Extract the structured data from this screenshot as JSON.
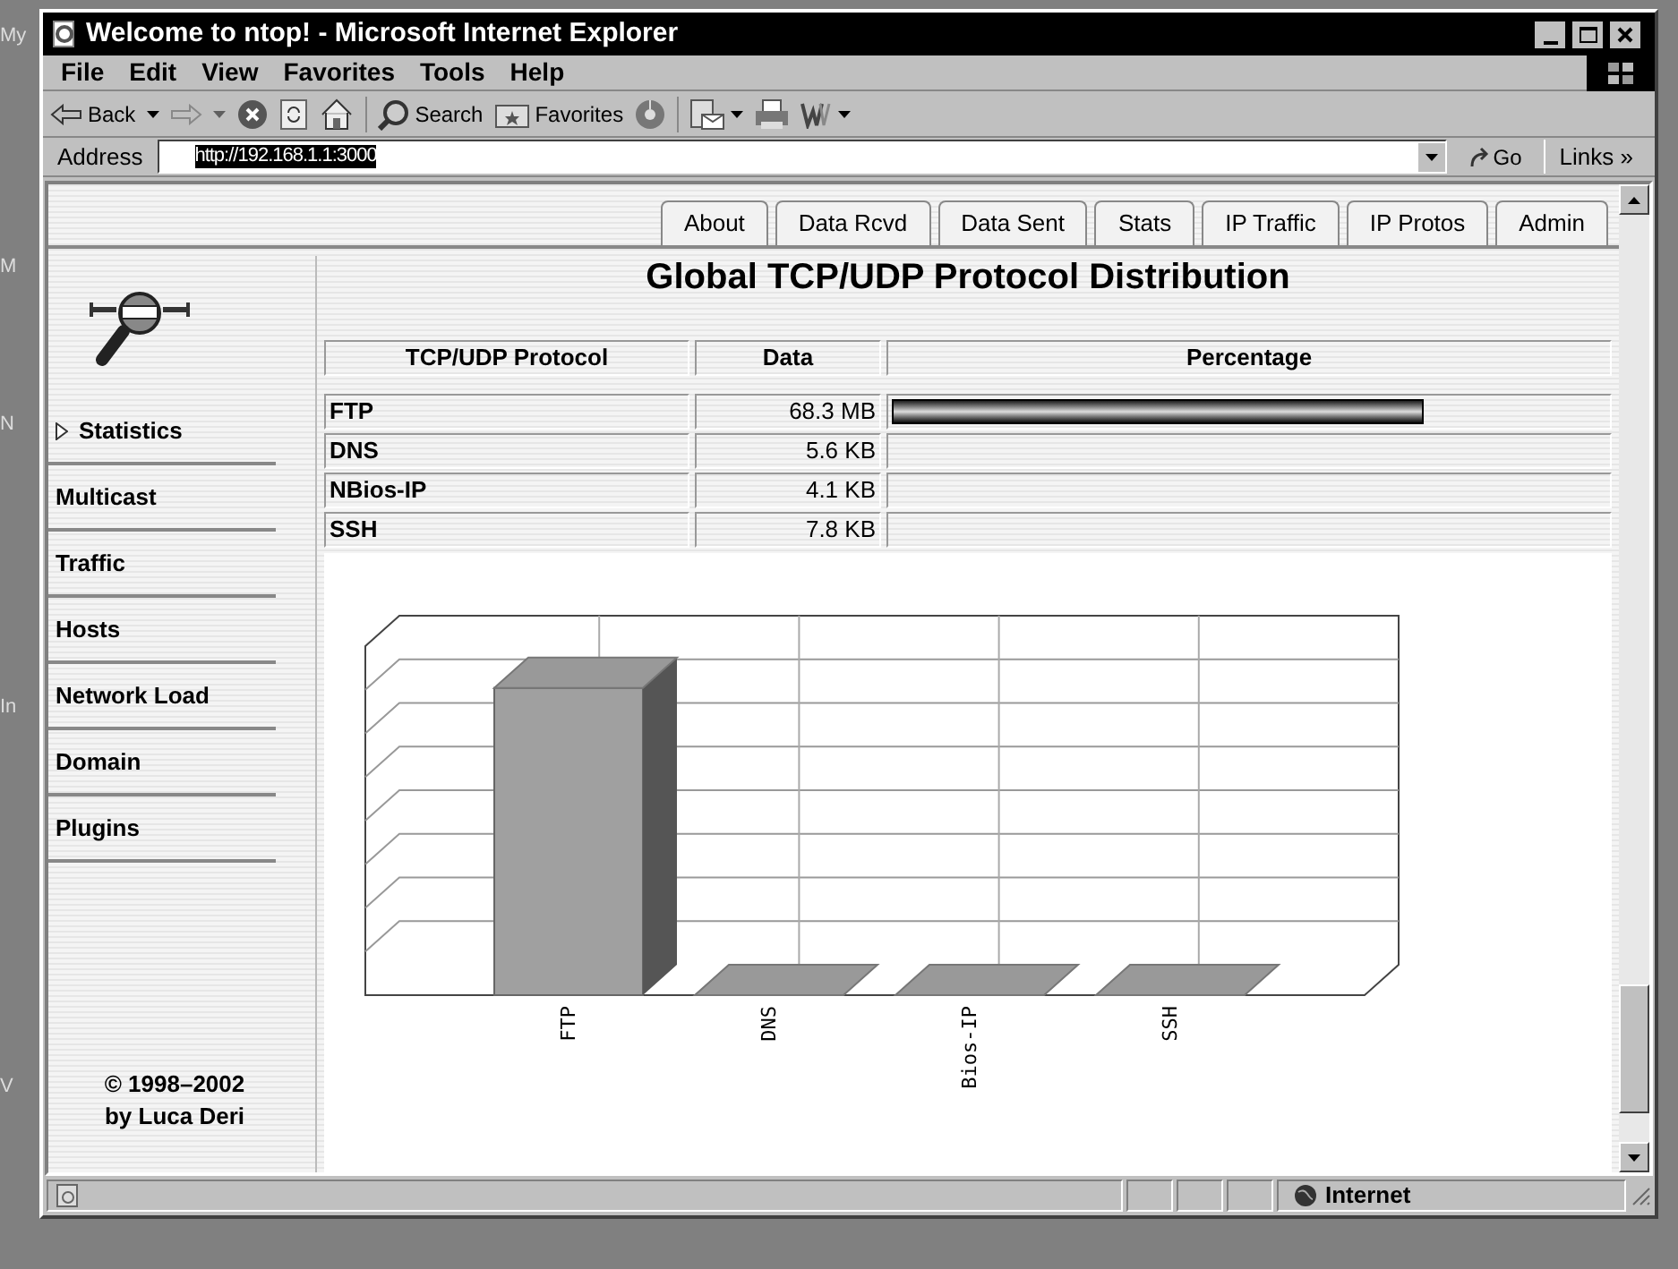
{
  "desktop_labels": [
    "My",
    "M",
    "N",
    "In",
    "V"
  ],
  "window": {
    "title": "Welcome to ntop! - Microsoft Internet Explorer"
  },
  "menu": [
    "File",
    "Edit",
    "View",
    "Favorites",
    "Tools",
    "Help"
  ],
  "toolbar": {
    "back": "Back",
    "search": "Search",
    "favorites": "Favorites"
  },
  "address_bar": {
    "label": "Address",
    "value": "http://192.168.1.1:3000",
    "go": "Go",
    "links": "Links »"
  },
  "tabs": [
    "About",
    "Data Rcvd",
    "Data Sent",
    "Stats",
    "IP Traffic",
    "IP Protos",
    "Admin"
  ],
  "sidebar": {
    "items": [
      {
        "label": "Statistics",
        "selected": true
      },
      {
        "label": "Multicast",
        "selected": false
      },
      {
        "label": "Traffic",
        "selected": false
      },
      {
        "label": "Hosts",
        "selected": false
      },
      {
        "label": "Network Load",
        "selected": false
      },
      {
        "label": "Domain",
        "selected": false
      },
      {
        "label": "Plugins",
        "selected": false
      }
    ],
    "footer": [
      "© 1998–2002",
      "by Luca Deri"
    ]
  },
  "page_title": "Global TCP/UDP Protocol Distribution",
  "table": {
    "columns": [
      "TCP/UDP Protocol",
      "Data",
      "Percentage"
    ],
    "rows": [
      {
        "protocol": "FTP",
        "data": "68.3 MB",
        "level": 0.74
      },
      {
        "protocol": "DNS",
        "data": "5.6 KB"
      },
      {
        "protocol": "NBios-IP",
        "data": "4.1 KB"
      },
      {
        "protocol": "SSH",
        "data": "7.8 KB"
      }
    ]
  },
  "chart": {
    "category_labels": [
      "FTP",
      "DNS",
      "Bios-IP",
      "SSH"
    ]
  },
  "status_bar": {
    "zone": "Internet"
  }
}
